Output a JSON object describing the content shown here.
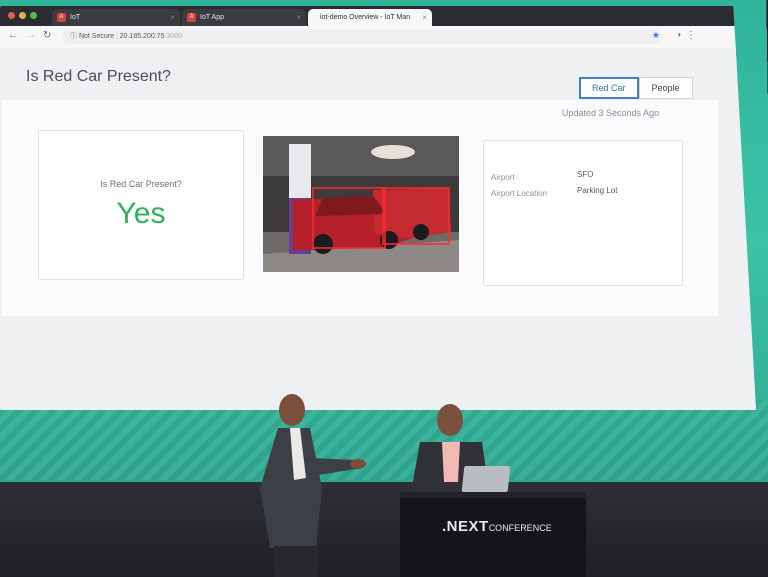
{
  "browser": {
    "tabs": [
      {
        "label": "IoT",
        "active": false
      },
      {
        "label": "IoT App",
        "active": false
      },
      {
        "label": "iot-demo Overview - IoT Man",
        "active": true
      }
    ],
    "url_status": "Not Secure",
    "url_host": "20.185.200.75",
    "url_port": ":3000"
  },
  "page": {
    "title": "Is Red Car Present?",
    "toggle": [
      {
        "label": "Red Car",
        "active": true
      },
      {
        "label": "People",
        "active": false
      }
    ],
    "updated": "Updated 3 Seconds Ago",
    "card": {
      "question": "Is Red Car Present?",
      "answer": "Yes"
    },
    "details": [
      {
        "label": "Airport",
        "value": "SFO"
      },
      {
        "label": "Airport Location",
        "value": "Parking Lot"
      }
    ]
  },
  "podium": {
    "brand": ".NEXT",
    "sub": "CONFERENCE"
  },
  "colors": {
    "wall": "#3cc3a6",
    "answer": "#2fb15b",
    "toggle_active": "#3c82c8"
  }
}
